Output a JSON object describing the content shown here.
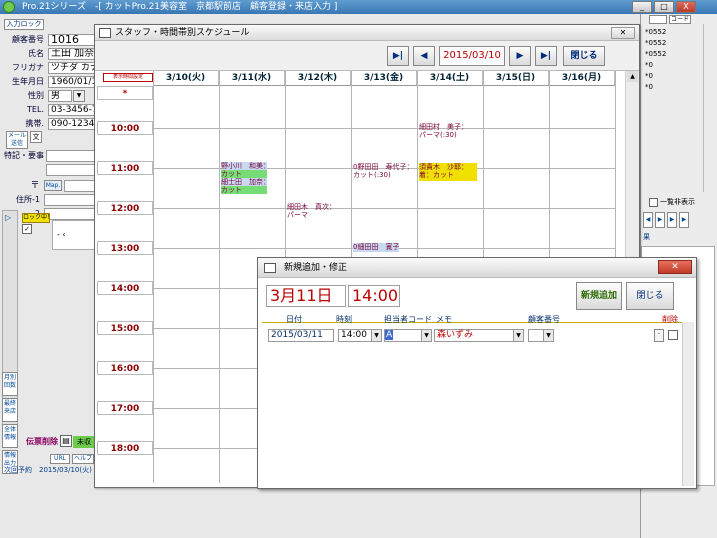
{
  "app": {
    "title": "Pro.21シリーズ　-[ カットPro.21美容室　京都駅前店　顧客登録・来店入力 ]",
    "min_label": "_",
    "restore_label": "□",
    "close_label": "X"
  },
  "customer": {
    "top_button": "入力ロック",
    "fields": [
      {
        "label": "顧客番号",
        "value": "1016"
      },
      {
        "label": "氏名",
        "value": "土田 加奈"
      },
      {
        "label": "フリガナ",
        "value": "ツチダ カナ"
      },
      {
        "label": "生年月日",
        "value": "1960/01/1"
      },
      {
        "label": "性別",
        "value": "男"
      },
      {
        "label": "TEL.",
        "value": "03-3456-78"
      },
      {
        "label": "携帯.",
        "value": "090-1234-5"
      }
    ],
    "mail_button": "メール送信",
    "mail_sub": "文",
    "notes_label": "特記・要事",
    "postal_label": "〒",
    "map_button": "Map.",
    "addr1_label": "住所-1",
    "addr2_label": "2",
    "lock_tag": "ロック中！",
    "side_tabs": [
      "月別\n回数",
      "最終\n来店",
      "全体\n情報",
      "情報\n出力"
    ],
    "delete_label": "伝票削除",
    "unpaid_label": "未収",
    "url_button": "URL",
    "help_button": "ヘルプ",
    "next_visit": "次回予約　2015/03/10(火)"
  },
  "right_panel": {
    "header": "コード",
    "items": [
      "*0552",
      "*0552",
      "*0552",
      "*0",
      "*0",
      "*0"
    ],
    "hide_label": "一覧非表示",
    "sub": "果"
  },
  "schedule": {
    "title": "スタッフ・時間帯別スケジュール",
    "close_x": "✕",
    "toolbar": {
      "first_btn": "▶|",
      "prev_btn": "◀",
      "date": "2015/03/10",
      "next_btn": "▶",
      "last_btn": "▶|",
      "close_btn": "閉じる",
      "setting_btn": "表示時間設定"
    },
    "days": [
      "3/10(火)",
      "3/11(水)",
      "3/12(木)",
      "3/13(金)",
      "3/14(土)",
      "3/15(日)",
      "3/16(月)"
    ],
    "times": [
      "*",
      "10:00",
      "11:00",
      "12:00",
      "13:00",
      "14:00",
      "15:00",
      "16:00",
      "17:00",
      "18:00"
    ],
    "appts": [
      {
        "name": "細田村　美子：",
        "menu": "パーマ(:30)"
      },
      {
        "name": "野小川　和美：",
        "menu": "カット"
      },
      {
        "name": "細士田　加奈：",
        "menu": "カット"
      },
      {
        "name": "0野田田　寿代子：",
        "menu": "カット(:30)"
      },
      {
        "name": "須貴木　沙耶：",
        "menu": "着：カット"
      },
      {
        "name": "細田木　真次：",
        "menu": "パーマ"
      },
      {
        "name": "0細田田　寛子：",
        "menu": ""
      }
    ]
  },
  "edit": {
    "title": "新規追加・修正",
    "close_x": "✕",
    "date_big": "3月11日",
    "time_big": "14:00",
    "add_button": "新規追加",
    "close_button": "閉じる",
    "headers": {
      "date": "日付",
      "time": "時刻",
      "staff": "担当者コード",
      "memo": "メモ",
      "cust": "顧客番号",
      "del": "削除"
    },
    "row": {
      "date": "2015/03/11",
      "time": "14:00",
      "staff": "A",
      "name": "森いずみ",
      "cust": ""
    }
  }
}
